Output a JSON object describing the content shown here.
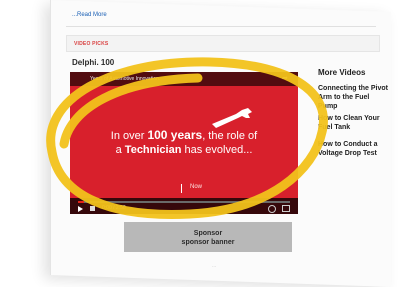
{
  "article": {
    "read_more": "...Read More"
  },
  "section": {
    "label": "VIDEO PICKS"
  },
  "video": {
    "title": "Delphi. 100",
    "top_bar_text": "Years of Automotive Innovation.",
    "headline_pre": "In over ",
    "headline_highlight": "100 years",
    "headline_post": ", the role of",
    "headline2_pre": "a ",
    "headline2_highlight": "Technician",
    "headline2_post": " has evolved...",
    "now_label": "Now",
    "time": "0:00 / 2:58",
    "progress": 0.03,
    "accent": "#d8202c",
    "icons": [
      "share-icon",
      "wrench-icon",
      "play-icon",
      "volume-icon",
      "settings-icon",
      "fullscreen-icon"
    ]
  },
  "sidebar": {
    "title": "More Videos",
    "items": [
      {
        "label": "Connecting the Pivot Arm to the Fuel Pump"
      },
      {
        "label": "How to Clean Your Fuel Tank"
      },
      {
        "label": "How to Conduct a Voltage Drop Test"
      }
    ]
  },
  "sponsor": {
    "line1": "Sponsor",
    "line2": "sponsor banner"
  },
  "footer": {
    "faint": "..."
  },
  "annotation": {
    "highlight_color": "#f2c21b"
  }
}
